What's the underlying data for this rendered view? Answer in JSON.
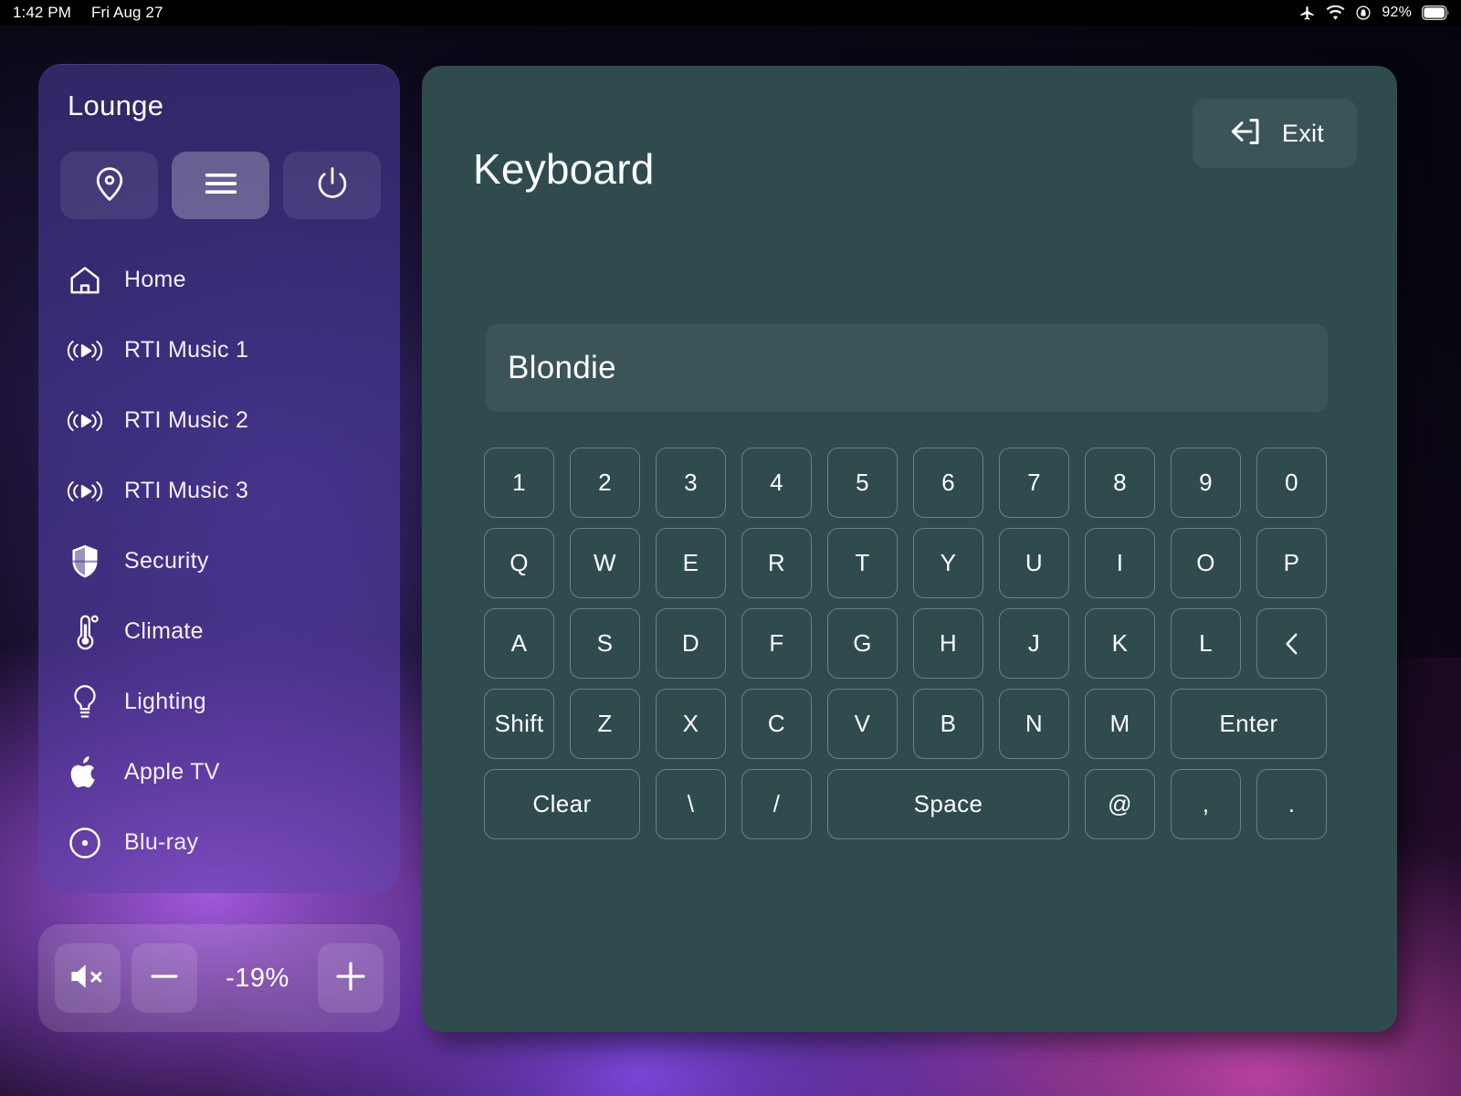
{
  "status_bar": {
    "time": "1:42 PM",
    "date": "Fri Aug 27",
    "battery_percent": "92%",
    "icons": [
      "airplane-mode-icon",
      "wifi-icon",
      "rotation-lock-icon",
      "battery-icon"
    ]
  },
  "sidebar": {
    "title": "Lounge",
    "toolbar": [
      {
        "name": "location-pin-button",
        "icon": "location-pin-icon",
        "active": false
      },
      {
        "name": "menu-button",
        "icon": "hamburger-menu-icon",
        "active": true
      },
      {
        "name": "power-button",
        "icon": "power-icon",
        "active": false
      }
    ],
    "items": [
      {
        "label": "Home",
        "icon": "house-icon"
      },
      {
        "label": "RTI Music 1",
        "icon": "audio-stream-icon"
      },
      {
        "label": "RTI Music 2",
        "icon": "audio-stream-icon"
      },
      {
        "label": "RTI Music 3",
        "icon": "audio-stream-icon"
      },
      {
        "label": "Security",
        "icon": "shield-icon"
      },
      {
        "label": "Climate",
        "icon": "thermometer-icon"
      },
      {
        "label": "Lighting",
        "icon": "lightbulb-icon"
      },
      {
        "label": "Apple TV",
        "icon": "apple-logo-icon"
      },
      {
        "label": "Blu-ray",
        "icon": "disc-icon"
      }
    ]
  },
  "volume": {
    "mute_icon": "speaker-mute-icon",
    "decrease_icon": "minus-icon",
    "increase_icon": "plus-icon",
    "value": "-19%"
  },
  "main": {
    "title": "Keyboard",
    "exit": {
      "label": "Exit",
      "icon": "exit-arrow-icon"
    },
    "text_field": {
      "value": "Blondie",
      "placeholder": ""
    },
    "keyboard_rows": [
      [
        {
          "label": "1",
          "width": 1
        },
        {
          "label": "2",
          "width": 1
        },
        {
          "label": "3",
          "width": 1
        },
        {
          "label": "4",
          "width": 1
        },
        {
          "label": "5",
          "width": 1
        },
        {
          "label": "6",
          "width": 1
        },
        {
          "label": "7",
          "width": 1
        },
        {
          "label": "8",
          "width": 1
        },
        {
          "label": "9",
          "width": 1
        },
        {
          "label": "0",
          "width": 1
        }
      ],
      [
        {
          "label": "Q",
          "width": 1
        },
        {
          "label": "W",
          "width": 1
        },
        {
          "label": "E",
          "width": 1
        },
        {
          "label": "R",
          "width": 1
        },
        {
          "label": "T",
          "width": 1
        },
        {
          "label": "Y",
          "width": 1
        },
        {
          "label": "U",
          "width": 1
        },
        {
          "label": "I",
          "width": 1
        },
        {
          "label": "O",
          "width": 1
        },
        {
          "label": "P",
          "width": 1
        }
      ],
      [
        {
          "label": "A",
          "width": 1
        },
        {
          "label": "S",
          "width": 1
        },
        {
          "label": "D",
          "width": 1
        },
        {
          "label": "F",
          "width": 1
        },
        {
          "label": "G",
          "width": 1
        },
        {
          "label": "H",
          "width": 1
        },
        {
          "label": "J",
          "width": 1
        },
        {
          "label": "K",
          "width": 1
        },
        {
          "label": "L",
          "width": 1
        },
        {
          "label": "",
          "width": 1,
          "icon": "backspace-chevron-icon",
          "name": "backspace-key"
        }
      ],
      [
        {
          "label": "Shift",
          "width": 1
        },
        {
          "label": "Z",
          "width": 1
        },
        {
          "label": "X",
          "width": 1
        },
        {
          "label": "C",
          "width": 1
        },
        {
          "label": "V",
          "width": 1
        },
        {
          "label": "B",
          "width": 1
        },
        {
          "label": "N",
          "width": 1
        },
        {
          "label": "M",
          "width": 1
        },
        {
          "label": "Enter",
          "width": 2
        }
      ],
      [
        {
          "label": "Clear",
          "width": 2
        },
        {
          "label": "\\",
          "width": 1
        },
        {
          "label": "/",
          "width": 1
        },
        {
          "label": "Space",
          "width": 3
        },
        {
          "label": "@",
          "width": 1
        },
        {
          "label": ",",
          "width": 1
        },
        {
          "label": ".",
          "width": 1
        }
      ]
    ]
  },
  "colors": {
    "panel_bg": "#2f4b4e",
    "sidebar_accent": "#6b4cb0",
    "text_primary": "#ffffff",
    "status_bar_bg": "#000000"
  }
}
